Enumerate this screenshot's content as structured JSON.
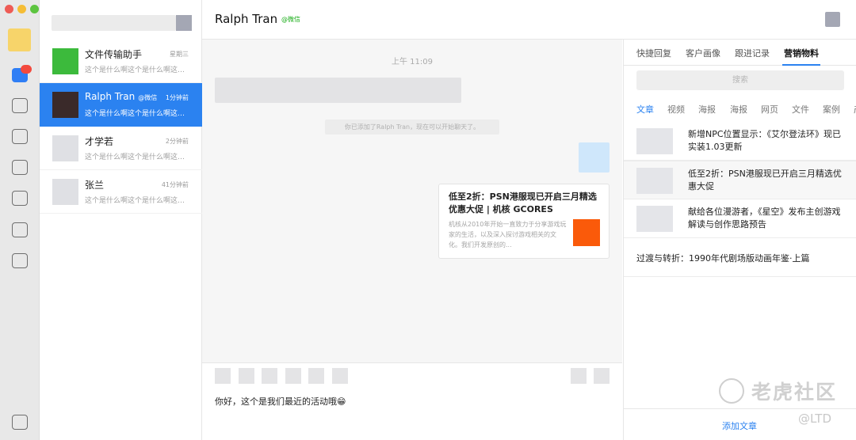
{
  "window": {
    "traffic_lights": [
      "close",
      "minimize",
      "zoom"
    ]
  },
  "rail": {
    "icons": [
      "app-avatar",
      "chat-icon",
      "square-icon",
      "square-icon",
      "square-icon",
      "square-icon",
      "square-icon",
      "square-icon",
      "square-icon"
    ]
  },
  "conversations": [
    {
      "name": "文件传输助手",
      "tag": "",
      "time": "星期三",
      "preview": "这个是什么啊这个是什么啊这个是什么啊",
      "thumb_color": "#3cba3c"
    },
    {
      "name": "Ralph Tran",
      "tag": "@微信",
      "time": "1分钟前",
      "preview": "这个是什么啊这个是什么啊这个是什么啊",
      "thumb_color": "#3a2a2a"
    },
    {
      "name": "才学若",
      "tag": "",
      "time": "2分钟前",
      "preview": "这个是什么啊这个是什么啊这个是什么啊",
      "thumb_color": "#dfe0e4"
    },
    {
      "name": "张兰",
      "tag": "",
      "time": "41分钟前",
      "preview": "这个是什么啊这个是什么啊这个是什么啊",
      "thumb_color": "#dfe0e4"
    }
  ],
  "header": {
    "name": "Ralph Tran",
    "tag": "@微信"
  },
  "chat": {
    "timestamp": "上午 11:09",
    "system_message": "你已添加了Ralph Tran，现在可以开始聊天了。",
    "card": {
      "title": "低至2折：PSN港服现已开启三月精选优惠大促 | 机核 GCORES",
      "description": "机核从2010年开始一直致力于分享游戏玩家的生活，以及深入探讨游戏相关的文化。我们开发原创的..."
    }
  },
  "composer": {
    "text": "你好，这个是我们最近的活动哦😁"
  },
  "right_panel": {
    "tabs": [
      "快捷回复",
      "客户画像",
      "跟进记录",
      "营销物料"
    ],
    "active_tab": "营销物料",
    "search_placeholder": "搜索",
    "categories": [
      "文章",
      "视频",
      "海报",
      "海报",
      "网页",
      "文件",
      "案例",
      "产"
    ],
    "articles": [
      {
        "title": "新增NPC位置显示：《艾尔登法环》现已实装1.03更新"
      },
      {
        "title": "低至2折：PSN港服现已开启三月精选优惠大促"
      },
      {
        "title": "献给各位漫游者，《星空》发布主创游戏解读与创作思路预告"
      }
    ],
    "plain_article": "过渡与转折：1990年代剧场版动画年鉴·上篇",
    "footer_link": "添加文章"
  },
  "watermark": {
    "text": "老虎社区",
    "sub": "@LTD"
  },
  "colors": {
    "accent": "#2b82f0",
    "wechat_green": "#1aad19",
    "card_thumb": "#fa5a0a"
  }
}
